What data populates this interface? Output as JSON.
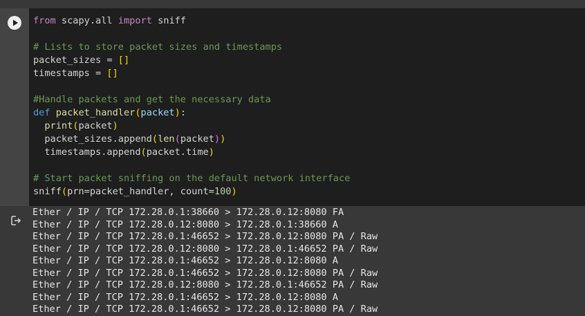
{
  "cell": {
    "run_icon": "play-circle-icon",
    "code_lines": [
      [
        {
          "t": "from",
          "c": "kw"
        },
        {
          "t": " scapy.all "
        },
        {
          "t": "import",
          "c": "kw"
        },
        {
          "t": " sniff"
        }
      ],
      [],
      [
        {
          "t": "# Lists to store packet sizes and timestamps",
          "c": "cm"
        }
      ],
      [
        {
          "t": "packet_sizes = "
        },
        {
          "t": "[]",
          "c": "br1"
        }
      ],
      [
        {
          "t": "timestamps = "
        },
        {
          "t": "[]",
          "c": "br1"
        }
      ],
      [],
      [
        {
          "t": "#Handle packets and get the necessary data",
          "c": "cm"
        }
      ],
      [
        {
          "t": "def",
          "c": "kwb"
        },
        {
          "t": " "
        },
        {
          "t": "packet_handler",
          "c": "fn"
        },
        {
          "t": "(",
          "c": "br1"
        },
        {
          "t": "packet",
          "c": "pm"
        },
        {
          "t": ")",
          "c": "br1"
        },
        {
          "t": ":"
        }
      ],
      [
        {
          "t": "  "
        },
        {
          "t": "print",
          "c": "fn"
        },
        {
          "t": "(",
          "c": "br1"
        },
        {
          "t": "packet"
        },
        {
          "t": ")",
          "c": "br1"
        }
      ],
      [
        {
          "t": "  packet_sizes.append"
        },
        {
          "t": "(",
          "c": "br1"
        },
        {
          "t": "len",
          "c": "fn"
        },
        {
          "t": "(",
          "c": "br2"
        },
        {
          "t": "packet"
        },
        {
          "t": ")",
          "c": "br2"
        },
        {
          "t": ")",
          "c": "br1"
        }
      ],
      [
        {
          "t": "  timestamps.append"
        },
        {
          "t": "(",
          "c": "br1"
        },
        {
          "t": "packet.time"
        },
        {
          "t": ")",
          "c": "br1"
        }
      ],
      [],
      [
        {
          "t": "# Start packet sniffing on the default network interface",
          "c": "cm"
        }
      ],
      [
        {
          "t": "sniff"
        },
        {
          "t": "(",
          "c": "br1"
        },
        {
          "t": "prn=packet_handler, count="
        },
        {
          "t": "100",
          "c": "num"
        },
        {
          "t": ")",
          "c": "br1"
        }
      ]
    ]
  },
  "output": {
    "icon": "output-redirect-icon",
    "lines": [
      "Ether / IP / TCP 172.28.0.1:38660 > 172.28.0.12:8080 FA",
      "Ether / IP / TCP 172.28.0.12:8080 > 172.28.0.1:38660 A",
      "Ether / IP / TCP 172.28.0.1:46652 > 172.28.0.12:8080 PA / Raw",
      "Ether / IP / TCP 172.28.0.12:8080 > 172.28.0.1:46652 PA / Raw",
      "Ether / IP / TCP 172.28.0.1:46652 > 172.28.0.12:8080 A",
      "Ether / IP / TCP 172.28.0.1:46652 > 172.28.0.12:8080 PA / Raw",
      "Ether / IP / TCP 172.28.0.12:8080 > 172.28.0.1:46652 PA / Raw",
      "Ether / IP / TCP 172.28.0.1:46652 > 172.28.0.12:8080 A",
      "Ether / IP / TCP 172.28.0.1:46652 > 172.28.0.12:8080 PA / Raw"
    ]
  }
}
